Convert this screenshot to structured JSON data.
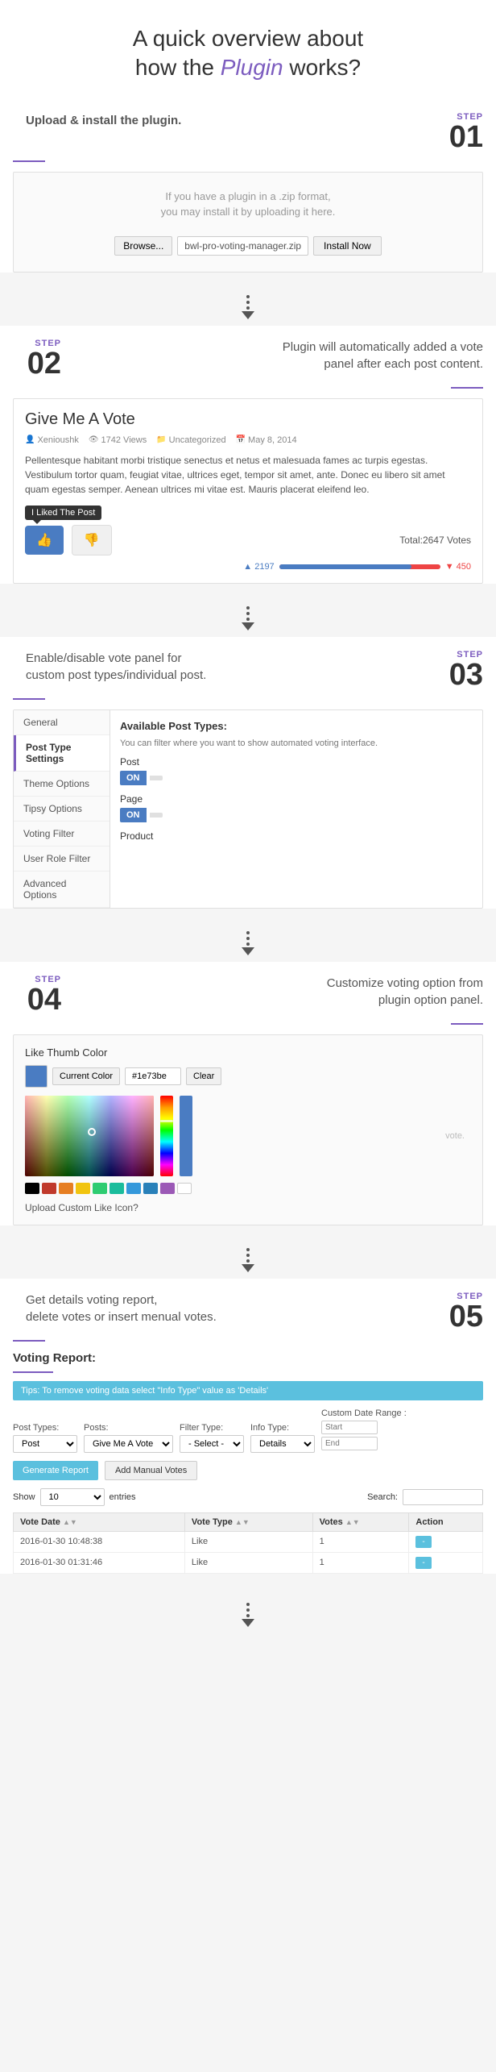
{
  "header": {
    "line1": "A quick overview about",
    "line2_pre": "how the ",
    "line2_highlight": "Plugin",
    "line2_post": " works?"
  },
  "steps": {
    "step01": {
      "label": "STEP",
      "number": "01",
      "description": "Upload & install the plugin.",
      "hint_line1": "If you have a plugin in a .zip format,",
      "hint_line2": "you may install it by uploading it here.",
      "browse_label": "Browse...",
      "file_name": "bwl-pro-voting-manager.zip",
      "install_label": "Install Now"
    },
    "step02": {
      "label": "STEP",
      "number": "02",
      "description_line1": "Plugin will automatically added a vote",
      "description_line2": "panel after each post content.",
      "post_title": "Give Me A Vote",
      "post_author": "Xenioushk",
      "post_views": "1742 Views",
      "post_category": "Uncategorized",
      "post_date": "May 8, 2014",
      "post_content": "Pellentesque habitant morbi tristique senectus et netus et malesuada fames ac turpis egestas. Vestibulum tortor quam, feugiat vitae, ultrices eget, tempor sit amet, ante. Donec eu libero sit amet quam egestas semper. Aenean ultrices mi vitae est. Mauris placerat eleifend leo.",
      "tooltip_text": "I Liked The Post",
      "total_votes": "Total:2647 Votes",
      "vote_like_count": "2197",
      "vote_dislike_count": "450"
    },
    "step03": {
      "label": "STEP",
      "number": "03",
      "description_line1": "Enable/disable vote panel for",
      "description_line2": "custom post types/individual post.",
      "sidebar_items": [
        "General",
        "Post Type Settings",
        "Theme Options",
        "Tipsy Options",
        "Voting Filter",
        "User Role Filter",
        "Advanced Options"
      ],
      "active_sidebar": "Post Type Settings",
      "settings_title": "Available Post Types:",
      "settings_hint": "You can filter where you want to show automated voting interface.",
      "post_types": [
        {
          "label": "Post",
          "state": "ON"
        },
        {
          "label": "Page",
          "state": "ON"
        },
        {
          "label": "Product",
          "state": ""
        }
      ]
    },
    "step04": {
      "label": "STEP",
      "number": "04",
      "description_line1": "Customize voting option from",
      "description_line2": "plugin option panel.",
      "color_section_title": "Like Thumb Color",
      "current_color_label": "Current Color",
      "color_hex": "#1e73be",
      "clear_label": "Clear",
      "upload_label": "Upload Custom Like Icon?"
    },
    "step05": {
      "label": "STEP",
      "number": "05",
      "description_line1": "Get details voting report,",
      "description_line2": "delete votes or insert menual votes.",
      "voting_report_title": "Voting Report:",
      "info_banner": "Tips: To remove voting data select \"Info Type\" value as 'Details'",
      "filter_labels": {
        "post_types": "Post Types:",
        "posts": "Posts:",
        "filter_type": "Filter Type:",
        "info_type": "Info Type:",
        "date_range": "Custom Date Range :",
        "start": "Start",
        "end": "End"
      },
      "post_types_value": "Post",
      "posts_value": "Give Me A Vote",
      "filter_type_value": "- Select -",
      "info_type_value": "Details",
      "generate_btn": "Generate Report",
      "manual_votes_btn": "Add Manual Votes",
      "show_label": "Show",
      "entries_label": "entries",
      "search_label": "Search:",
      "table_headers": [
        "Vote Date",
        "Vote Type",
        "Votes",
        "Action"
      ],
      "table_rows": [
        {
          "date": "2016-01-30 10:48:38",
          "type": "Like",
          "votes": "1",
          "action": "-"
        },
        {
          "date": "2016-01-30 01:31:46",
          "type": "Like",
          "votes": "1",
          "action": "-"
        }
      ]
    }
  }
}
